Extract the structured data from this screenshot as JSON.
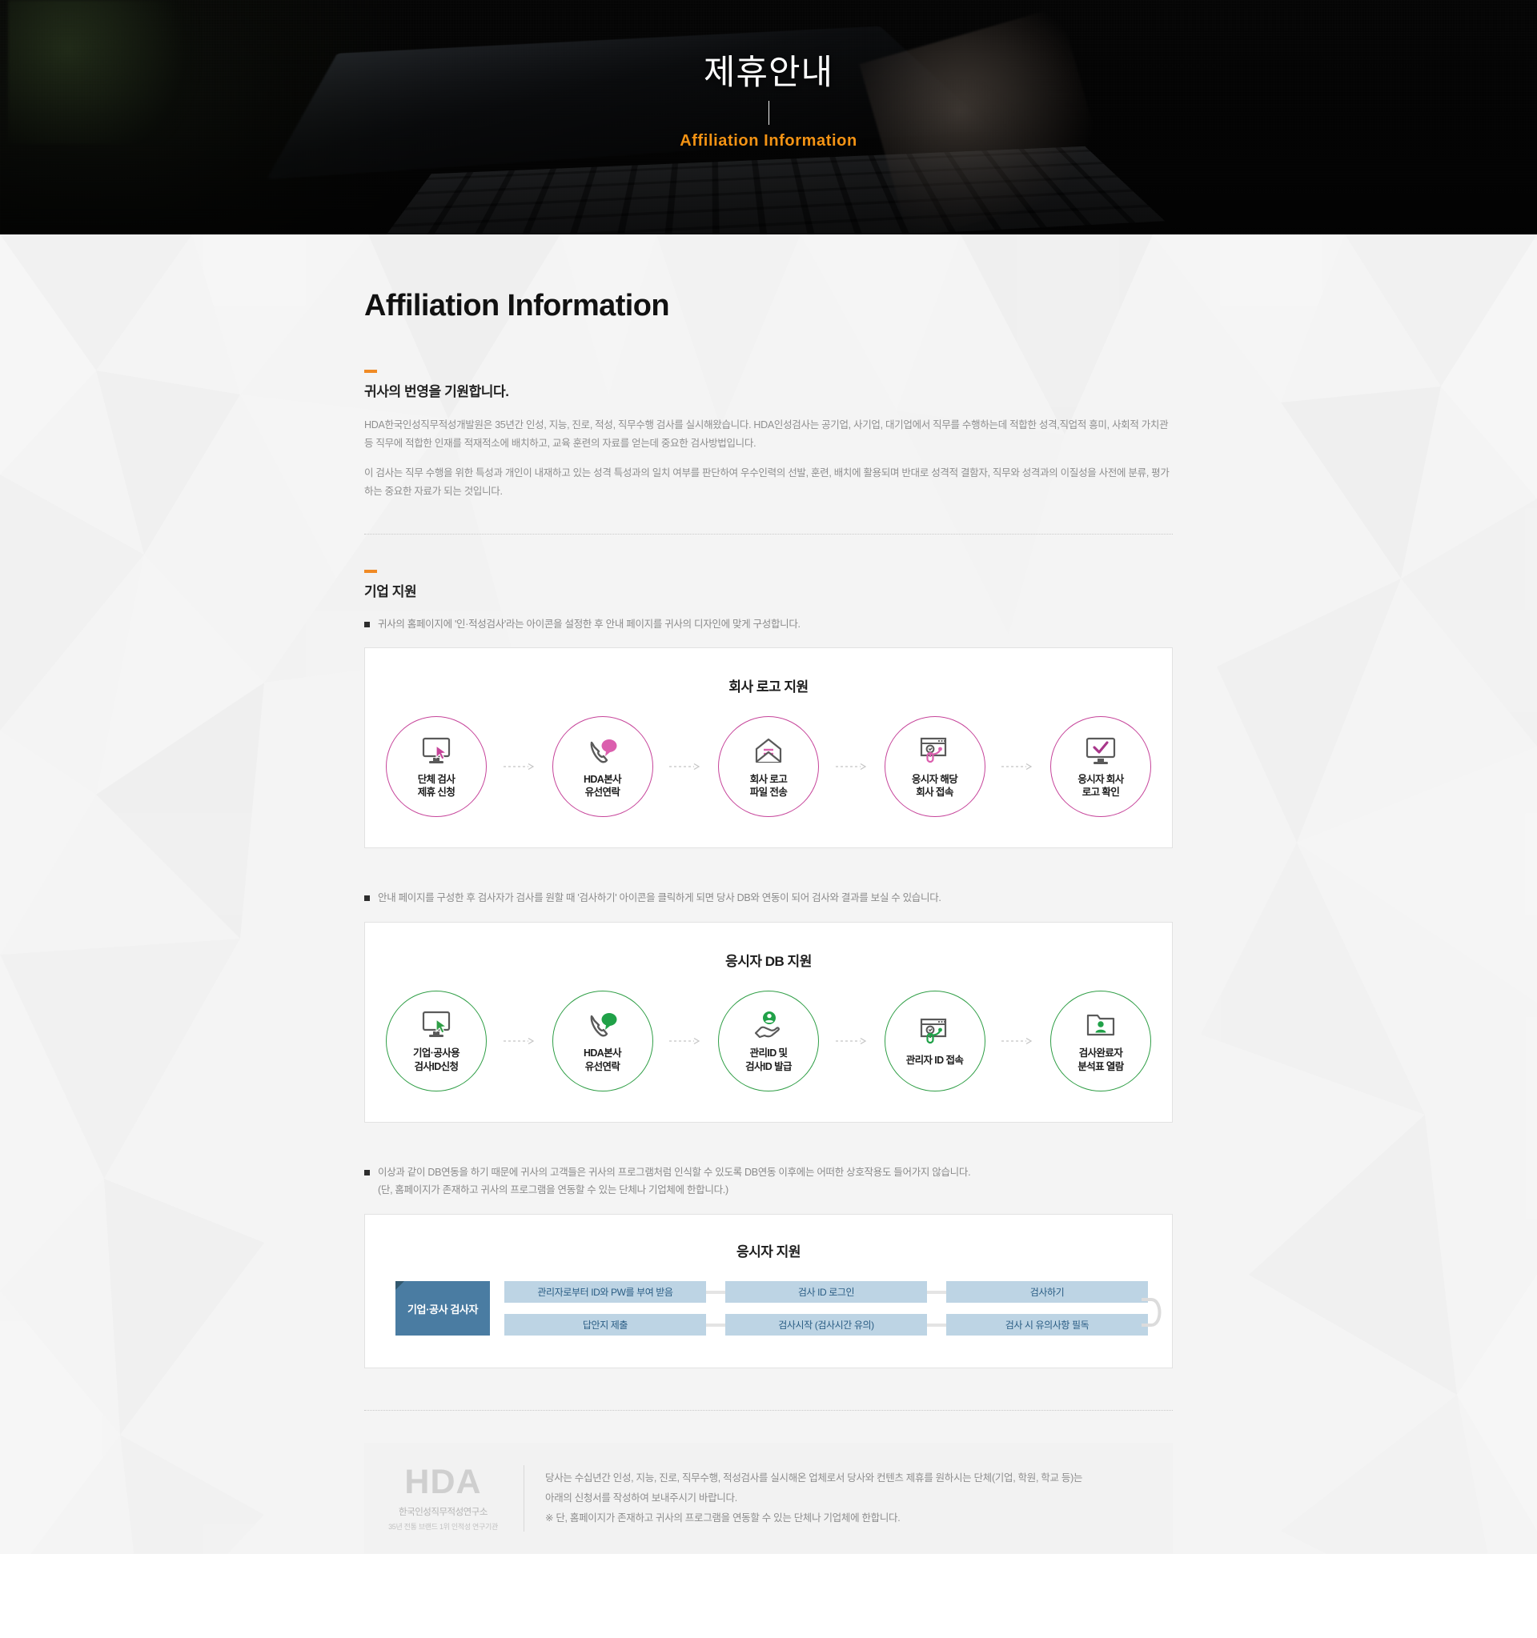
{
  "hero": {
    "title_ko": "제휴안내",
    "title_en": "Affiliation Information"
  },
  "page": {
    "title": "Affiliation Information"
  },
  "intro": {
    "heading": "귀사의 번영을 기원합니다.",
    "para1": "HDA한국인성직무적성개발원은 35년간 인성, 지능, 진로, 적성, 직무수행 검사를 실시해왔습니다. HDA인성검사는 공기업, 사기업, 대기업에서 직무를 수행하는데 적합한 성격,직업적 흥미, 사회적 가치관 등 직무에 적합한 인재를 적재적소에 배치하고, 교육 훈련의 자료를 얻는데 중요한 검사방법입니다.",
    "para2": "이 검사는 직무 수행을 위한 특성과 개인이 내재하고 있는 성격 특성과의 일치 여부를 판단하여 우수인력의 선발, 훈련, 배치에 활용되며 반대로 성격적 결함자, 직무와 성격과의 이질성을 사전에 분류, 평가하는 중요한 자료가 되는 것입니다."
  },
  "corporate": {
    "heading": "기업 지원",
    "bullet1": "귀사의 홈페이지에 '인·적성검사'라는 아이콘을 설정한 후 안내 페이지를 귀사의 디자인에 맞게 구성합니다.",
    "bullet2": "안내 페이지를 구성한 후 검사자가 검사를 원할 때 '검사하기' 아이콘을 클릭하게 되면 당사 DB와 연동이 되어 검사와 결과를 보실 수 있습니다.",
    "bullet3_line1": "이상과 같이 DB연동을 하기 때문에 귀사의 고객들은 귀사의 프로그램처럼 인식할 수 있도록 DB연동 이후에는 어떠한 상호작용도 들어가지 않습니다.",
    "bullet3_line2": "(단, 홈페이지가 존재하고 귀사의 프로그램을 연동할 수 있는 단체나 기업체에 한합니다.)"
  },
  "flow_logo": {
    "title": "회사 로고 지원",
    "color": "#c6449a",
    "steps": [
      {
        "label": "단체 검사\n제휴 신청",
        "icon": "monitor-cursor-icon"
      },
      {
        "label": "HDA본사\n유선연락",
        "icon": "phone-chat-icon"
      },
      {
        "label": "회사 로고\n파일 전송",
        "icon": "envelope-icon"
      },
      {
        "label": "응시자 해당\n회사 접속",
        "icon": "browser-click-icon"
      },
      {
        "label": "응시자 회사\n로고 확인",
        "icon": "monitor-check-icon"
      }
    ]
  },
  "flow_db": {
    "title": "응시자 DB 지원",
    "color": "#2f9e46",
    "steps": [
      {
        "label": "기업·공사용\n검사ID신청",
        "icon": "monitor-cursor-icon"
      },
      {
        "label": "HDA본사\n유선연락",
        "icon": "phone-chat-icon"
      },
      {
        "label": "관리ID 및\n검사ID 발급",
        "icon": "hand-user-icon"
      },
      {
        "label": "관리자 ID 접속",
        "icon": "browser-click-icon"
      },
      {
        "label": "검사완료자\n분석표 열람",
        "icon": "folder-user-icon"
      }
    ]
  },
  "flow_blue": {
    "title": "응시자 지원",
    "tag": "기업·공사 검사자",
    "row1": [
      "관리자로부터 ID와 PW를 부여 받음",
      "검사 ID 로그인",
      "검사하기"
    ],
    "row2": [
      "답안지 제출",
      "검사시작 (검사시간 유의)",
      "검사 시 유의사항 필독"
    ],
    "accent": "#4a7ca2",
    "cell_bg": "#bdd4e4"
  },
  "footer": {
    "logo_mark": "HDA",
    "logo_ko": "한국인성직무적성연구소",
    "logo_sub": "35년 전통 브랜드 1위 인적성 연구기관",
    "line1": "당사는 수십년간 인성, 지능, 진로, 직무수행, 적성검사를 실시해온 업체로서 당사와 컨텐츠 제휴를 원하시는 단체(기업, 학원, 학교 등)는",
    "line2": "아래의 신청서를 작성하여 보내주시기 바랍니다.",
    "line3": "※ 단, 홈페이지가 존재하고 귀사의 프로그램을 연동할 수 있는 단체나 기업체에 한합니다."
  }
}
